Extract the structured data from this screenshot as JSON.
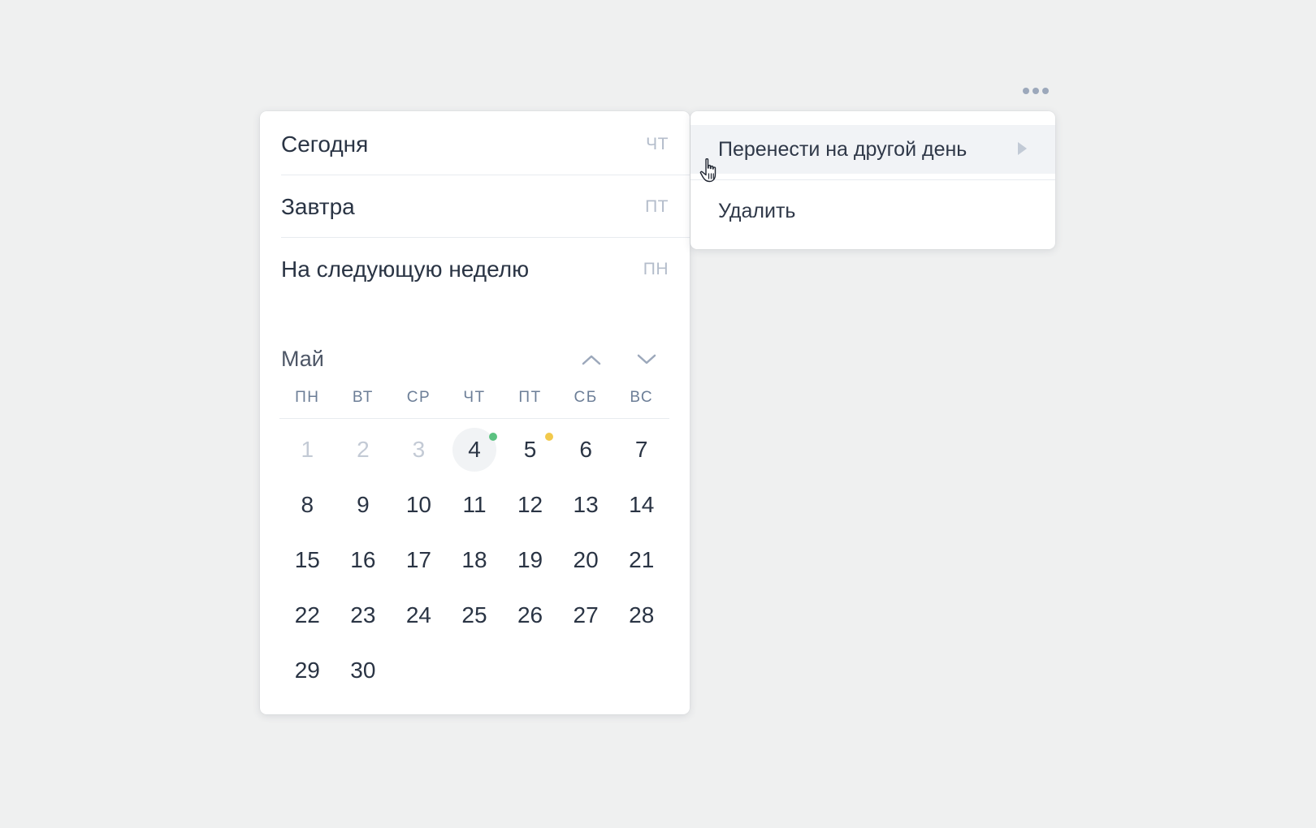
{
  "quick_options": [
    {
      "label": "Сегодня",
      "day": "ЧТ"
    },
    {
      "label": "Завтра",
      "day": "ПТ"
    },
    {
      "label": "На следующую неделю",
      "day": "ПН"
    }
  ],
  "calendar": {
    "month": "Май",
    "weekdays": [
      "ПН",
      "ВТ",
      "СР",
      "ЧТ",
      "ПТ",
      "СБ",
      "ВС"
    ],
    "days": [
      "1",
      "2",
      "3",
      "4",
      "5",
      "6",
      "7",
      "8",
      "9",
      "10",
      "11",
      "12",
      "13",
      "14",
      "15",
      "16",
      "17",
      "18",
      "19",
      "20",
      "21",
      "22",
      "23",
      "24",
      "25",
      "26",
      "27",
      "28",
      "29",
      "30"
    ],
    "today": "4",
    "past_days": [
      "1",
      "2",
      "3"
    ],
    "markers": {
      "4": "#5cc281",
      "5": "#f2c94c"
    }
  },
  "context_menu": {
    "items": [
      {
        "label": "Перенести на другой день",
        "has_submenu": true
      },
      {
        "label": "Удалить",
        "has_submenu": false
      }
    ]
  },
  "icons": {
    "more": "more-horizontal-icon",
    "prev_month": "chevron-up-icon",
    "next_month": "chevron-down-icon",
    "submenu": "caret-right-icon",
    "cursor": "hand-pointer-icon"
  },
  "colors": {
    "background": "#eff0f0",
    "panel": "#ffffff",
    "text": "#2a3444",
    "muted": "#b4bdcb",
    "weekday": "#6c7e97",
    "highlight": "#f1f3f6"
  }
}
